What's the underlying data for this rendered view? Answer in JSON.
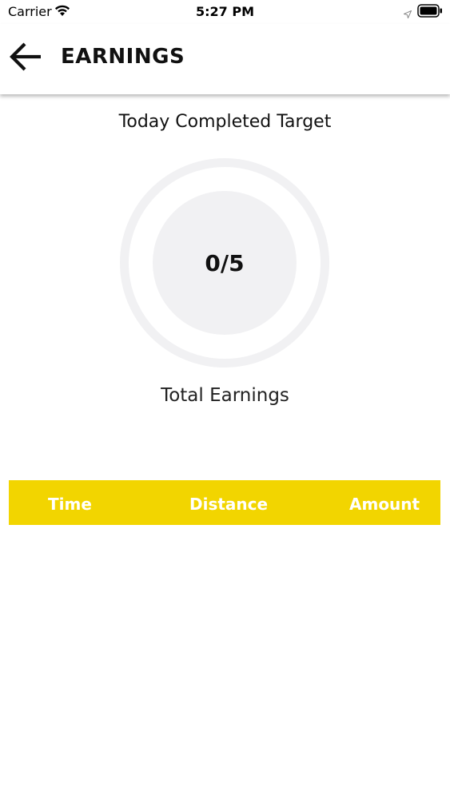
{
  "status_bar": {
    "carrier": "Carrier",
    "time": "5:27 PM",
    "icons": [
      "wifi-icon",
      "location-icon",
      "battery-icon"
    ]
  },
  "header": {
    "title": "EARNINGS",
    "back_icon": "arrow-left-icon"
  },
  "target": {
    "title": "Today Completed Target",
    "progress": "0/5",
    "completed": 0,
    "total": 5
  },
  "earnings": {
    "label": "Total Earnings"
  },
  "table": {
    "columns": [
      "Time",
      "Distance",
      "Amount"
    ],
    "rows": []
  },
  "colors": {
    "accent": "#f2d500",
    "ring": "#f1f1f3",
    "header_text": "#ffffff"
  }
}
